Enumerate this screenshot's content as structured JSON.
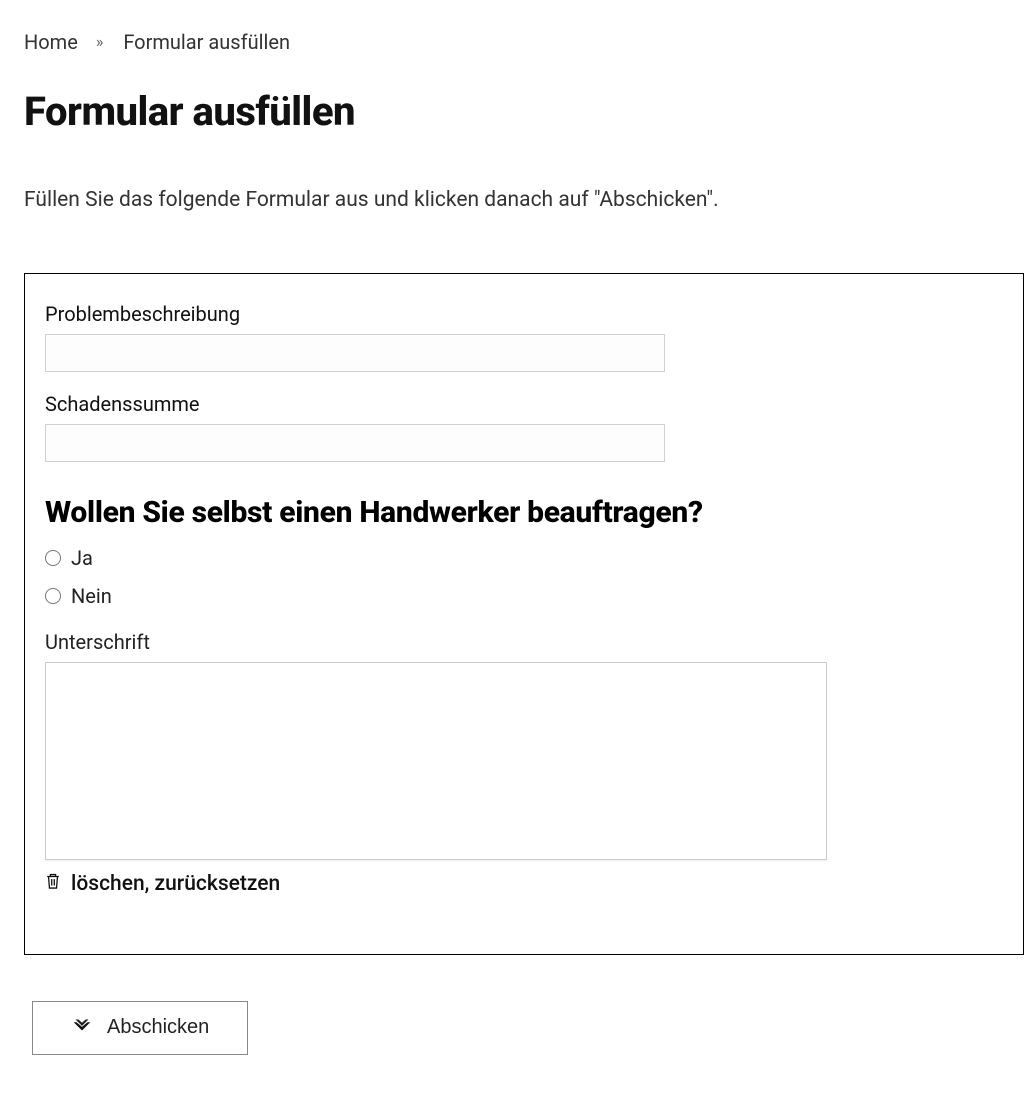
{
  "breadcrumb": {
    "home": "Home",
    "separator": "»",
    "current": "Formular ausfüllen"
  },
  "page": {
    "title": "Formular ausfüllen",
    "intro": "Füllen Sie das folgende Formular aus und klicken danach auf \"Abschicken\"."
  },
  "form": {
    "problem_label": "Problembeschreibung",
    "problem_value": "",
    "damage_label": "Schadenssumme",
    "damage_value": "",
    "question_heading": "Wollen Sie selbst einen Handwerker beauftragen?",
    "option_yes": "Ja",
    "option_no": "Nein",
    "signature_label": "Unterschrift",
    "clear_label": "löschen, zurücksetzen",
    "submit_label": "Abschicken"
  },
  "icons": {
    "trash": "trash-icon",
    "submit": "check-icon"
  }
}
